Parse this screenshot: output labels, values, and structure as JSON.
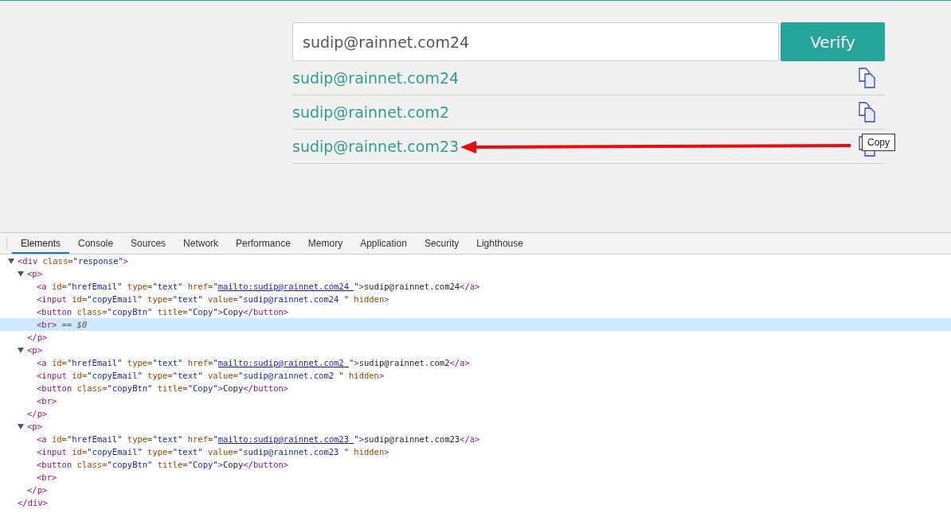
{
  "form": {
    "email_value": "sudip@rainnet.com24",
    "verify_button": "Verify"
  },
  "results": [
    {
      "email": "sudip@rainnet.com24"
    },
    {
      "email": "sudip@rainnet.com2"
    },
    {
      "email": "sudip@rainnet.com23",
      "tooltip": "Copy",
      "annotated": true
    }
  ],
  "devtools": {
    "tabs": [
      {
        "label": "Elements",
        "selected": true
      },
      {
        "label": "Console",
        "selected": false
      },
      {
        "label": "Sources",
        "selected": false
      },
      {
        "label": "Network",
        "selected": false
      },
      {
        "label": "Performance",
        "selected": false
      },
      {
        "label": "Memory",
        "selected": false
      },
      {
        "label": "Application",
        "selected": false
      },
      {
        "label": "Security",
        "selected": false
      },
      {
        "label": "Lighthouse",
        "selected": false
      }
    ],
    "tree": [
      {
        "expanded": true,
        "open": [
          {
            "kind": "tag",
            "text": "<div"
          },
          {
            "kind": "attr",
            "text": " class="
          },
          {
            "kind": "val",
            "text": "\"response\""
          },
          {
            "kind": "tag",
            "text": ">"
          }
        ],
        "children": [
          {
            "expanded": true,
            "open": [
              {
                "kind": "tag",
                "text": "<p>"
              }
            ],
            "children": [
              {
                "selected": false,
                "tokens": [
                  {
                    "kind": "tag",
                    "text": "<a"
                  },
                  {
                    "kind": "attr",
                    "text": " id="
                  },
                  {
                    "kind": "val",
                    "text": "\"hrefEmail\""
                  },
                  {
                    "kind": "attr",
                    "text": " type="
                  },
                  {
                    "kind": "val",
                    "text": "\"text\""
                  },
                  {
                    "kind": "attr",
                    "text": " href="
                  },
                  {
                    "kind": "val",
                    "text": "\""
                  },
                  {
                    "kind": "link",
                    "text": "mailto:sudip@rainnet.com24 "
                  },
                  {
                    "kind": "val",
                    "text": "\""
                  },
                  {
                    "kind": "tag",
                    "text": ">"
                  },
                  {
                    "kind": "text",
                    "text": "sudip@rainnet.com24"
                  },
                  {
                    "kind": "tag",
                    "text": "</a>"
                  }
                ]
              },
              {
                "selected": false,
                "tokens": [
                  {
                    "kind": "tag",
                    "text": "<input"
                  },
                  {
                    "kind": "attr",
                    "text": " id="
                  },
                  {
                    "kind": "val",
                    "text": "\"copyEmail\""
                  },
                  {
                    "kind": "attr",
                    "text": " type="
                  },
                  {
                    "kind": "val",
                    "text": "\"text\""
                  },
                  {
                    "kind": "attr",
                    "text": " value="
                  },
                  {
                    "kind": "val",
                    "text": "\"sudip@rainnet.com24 \""
                  },
                  {
                    "kind": "attr",
                    "text": " hidden"
                  },
                  {
                    "kind": "tag",
                    "text": ">"
                  }
                ]
              },
              {
                "selected": false,
                "tokens": [
                  {
                    "kind": "tag",
                    "text": "<button"
                  },
                  {
                    "kind": "attr",
                    "text": " class="
                  },
                  {
                    "kind": "val",
                    "text": "\"copyBtn\""
                  },
                  {
                    "kind": "attr",
                    "text": " title="
                  },
                  {
                    "kind": "val",
                    "text": "\"Copy\""
                  },
                  {
                    "kind": "tag",
                    "text": ">"
                  },
                  {
                    "kind": "text",
                    "text": "Copy"
                  },
                  {
                    "kind": "tag",
                    "text": "</button>"
                  }
                ]
              },
              {
                "selected": true,
                "tokens": [
                  {
                    "kind": "tag",
                    "text": "<br>"
                  },
                  {
                    "kind": "hint",
                    "text": " == $0"
                  }
                ]
              }
            ],
            "close": [
              {
                "kind": "tag",
                "text": "</p>"
              }
            ]
          },
          {
            "expanded": true,
            "open": [
              {
                "kind": "tag",
                "text": "<p>"
              }
            ],
            "children": [
              {
                "selected": false,
                "tokens": [
                  {
                    "kind": "tag",
                    "text": "<a"
                  },
                  {
                    "kind": "attr",
                    "text": " id="
                  },
                  {
                    "kind": "val",
                    "text": "\"hrefEmail\""
                  },
                  {
                    "kind": "attr",
                    "text": " type="
                  },
                  {
                    "kind": "val",
                    "text": "\"text\""
                  },
                  {
                    "kind": "attr",
                    "text": " href="
                  },
                  {
                    "kind": "val",
                    "text": "\""
                  },
                  {
                    "kind": "link",
                    "text": "mailto:sudip@rainnet.com2 "
                  },
                  {
                    "kind": "val",
                    "text": "\""
                  },
                  {
                    "kind": "tag",
                    "text": ">"
                  },
                  {
                    "kind": "text",
                    "text": "sudip@rainnet.com2"
                  },
                  {
                    "kind": "tag",
                    "text": "</a>"
                  }
                ]
              },
              {
                "selected": false,
                "tokens": [
                  {
                    "kind": "tag",
                    "text": "<input"
                  },
                  {
                    "kind": "attr",
                    "text": " id="
                  },
                  {
                    "kind": "val",
                    "text": "\"copyEmail\""
                  },
                  {
                    "kind": "attr",
                    "text": " type="
                  },
                  {
                    "kind": "val",
                    "text": "\"text\""
                  },
                  {
                    "kind": "attr",
                    "text": " value="
                  },
                  {
                    "kind": "val",
                    "text": "\"sudip@rainnet.com2 \""
                  },
                  {
                    "kind": "attr",
                    "text": " hidden"
                  },
                  {
                    "kind": "tag",
                    "text": ">"
                  }
                ]
              },
              {
                "selected": false,
                "tokens": [
                  {
                    "kind": "tag",
                    "text": "<button"
                  },
                  {
                    "kind": "attr",
                    "text": " class="
                  },
                  {
                    "kind": "val",
                    "text": "\"copyBtn\""
                  },
                  {
                    "kind": "attr",
                    "text": " title="
                  },
                  {
                    "kind": "val",
                    "text": "\"Copy\""
                  },
                  {
                    "kind": "tag",
                    "text": ">"
                  },
                  {
                    "kind": "text",
                    "text": "Copy"
                  },
                  {
                    "kind": "tag",
                    "text": "</button>"
                  }
                ]
              },
              {
                "selected": false,
                "tokens": [
                  {
                    "kind": "tag",
                    "text": "<br>"
                  }
                ]
              }
            ],
            "close": [
              {
                "kind": "tag",
                "text": "</p>"
              }
            ]
          },
          {
            "expanded": true,
            "open": [
              {
                "kind": "tag",
                "text": "<p>"
              }
            ],
            "children": [
              {
                "selected": false,
                "tokens": [
                  {
                    "kind": "tag",
                    "text": "<a"
                  },
                  {
                    "kind": "attr",
                    "text": " id="
                  },
                  {
                    "kind": "val",
                    "text": "\"hrefEmail\""
                  },
                  {
                    "kind": "attr",
                    "text": " type="
                  },
                  {
                    "kind": "val",
                    "text": "\"text\""
                  },
                  {
                    "kind": "attr",
                    "text": " href="
                  },
                  {
                    "kind": "val",
                    "text": "\""
                  },
                  {
                    "kind": "link",
                    "text": "mailto:sudip@rainnet.com23 "
                  },
                  {
                    "kind": "val",
                    "text": "\""
                  },
                  {
                    "kind": "tag",
                    "text": ">"
                  },
                  {
                    "kind": "text",
                    "text": "sudip@rainnet.com23"
                  },
                  {
                    "kind": "tag",
                    "text": "</a>"
                  }
                ]
              },
              {
                "selected": false,
                "tokens": [
                  {
                    "kind": "tag",
                    "text": "<input"
                  },
                  {
                    "kind": "attr",
                    "text": " id="
                  },
                  {
                    "kind": "val",
                    "text": "\"copyEmail\""
                  },
                  {
                    "kind": "attr",
                    "text": " type="
                  },
                  {
                    "kind": "val",
                    "text": "\"text\""
                  },
                  {
                    "kind": "attr",
                    "text": " value="
                  },
                  {
                    "kind": "val",
                    "text": "\"sudip@rainnet.com23 \""
                  },
                  {
                    "kind": "attr",
                    "text": " hidden"
                  },
                  {
                    "kind": "tag",
                    "text": ">"
                  }
                ]
              },
              {
                "selected": false,
                "tokens": [
                  {
                    "kind": "tag",
                    "text": "<button"
                  },
                  {
                    "kind": "attr",
                    "text": " class="
                  },
                  {
                    "kind": "val",
                    "text": "\"copyBtn\""
                  },
                  {
                    "kind": "attr",
                    "text": " title="
                  },
                  {
                    "kind": "val",
                    "text": "\"Copy\""
                  },
                  {
                    "kind": "tag",
                    "text": ">"
                  },
                  {
                    "kind": "text",
                    "text": "Copy"
                  },
                  {
                    "kind": "tag",
                    "text": "</button>"
                  }
                ]
              },
              {
                "selected": false,
                "tokens": [
                  {
                    "kind": "tag",
                    "text": "<br>"
                  }
                ]
              }
            ],
            "close": [
              {
                "kind": "tag",
                "text": "</p>"
              }
            ]
          }
        ],
        "close": [
          {
            "kind": "tag",
            "text": "</div>"
          }
        ]
      }
    ]
  }
}
